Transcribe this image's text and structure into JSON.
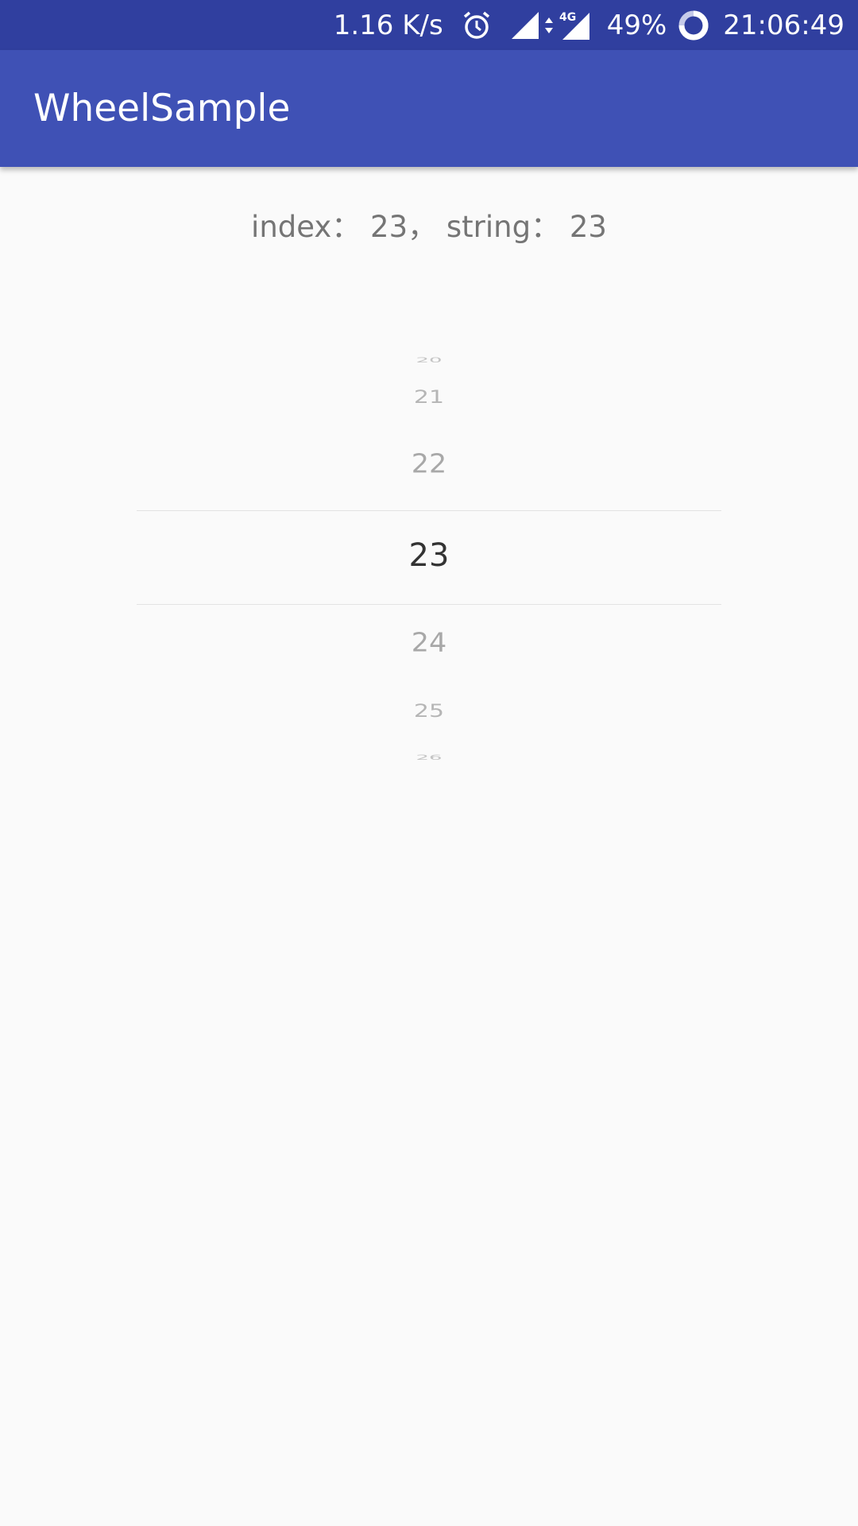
{
  "status_bar": {
    "net_speed": "1.16 K/s",
    "network_type": "4G",
    "battery": "49%",
    "time": "21:06:49",
    "icons": [
      "alarm-icon",
      "signal-icon",
      "data-arrows-icon",
      "lte-signal-icon",
      "battery-saver-icon"
    ]
  },
  "app_bar": {
    "title": "WheelSample",
    "color": "#3f51b5",
    "status_color": "#303f9f"
  },
  "result": {
    "text": "index： 23， string： 23"
  },
  "wheel": {
    "selected_index": 23,
    "items": {
      "i20": "20",
      "i21": "21",
      "i22": "22",
      "i23": "23",
      "i24": "24",
      "i25": "25",
      "i26": "26"
    }
  }
}
